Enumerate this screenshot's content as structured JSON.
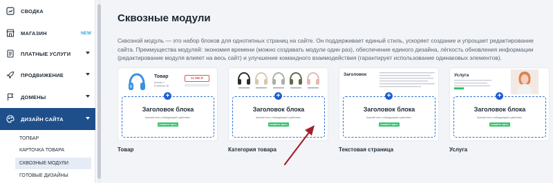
{
  "sidebar": {
    "items": [
      {
        "label": "СВОДКА",
        "icon": "dashboard-icon",
        "chevron": false
      },
      {
        "label": "МАГАЗИН",
        "icon": "store-icon",
        "badge": "NEW",
        "chevron": false
      },
      {
        "label": "ПЛАТНЫЕ УСЛУГИ",
        "icon": "document-icon",
        "chevron": true
      },
      {
        "label": "ПРОДВИЖЕНИЕ",
        "icon": "rocket-icon",
        "chevron": true
      },
      {
        "label": "ДОМЕНЫ",
        "icon": "flag-icon",
        "chevron": true
      },
      {
        "label": "ДИЗАЙН САЙТА",
        "icon": "palette-icon",
        "chevron": true,
        "active": true
      }
    ],
    "subitems": [
      {
        "label": "ТОПБАР"
      },
      {
        "label": "КАРТОЧКА ТОВАРА"
      },
      {
        "label": "СКВОЗНЫЕ МОДУЛИ",
        "active": true
      },
      {
        "label": "ГОТОВЫЕ ДИЗАЙНЫ"
      }
    ]
  },
  "main": {
    "title": "Сквозные модули",
    "description": "Сквозной модуль — это набор блоков для однотипных страниц на сайте. Он поддерживает единый стиль, ускоряет создание и упрощает редактирование сайта. Преимущества модулей: экономия времени (можно создавать модули один раз), обеспечение единого дизайна, лёгкость обновления информации (редактирование модуля влияет на весь сайт) и улучшение командного взаимодействия (гарантирует использование одинаковых элементов).",
    "cards": [
      {
        "label": "Товар",
        "block_title": "Заголовок блока",
        "block_sub": "Краткий текст, побуждающий к действию.",
        "block_btn": "НАЖМИТЕ ЗДЕСЬ",
        "preview": {
          "heading": "Товар",
          "price": "12 990 ₽",
          "line1": "Артикул: 1",
          "line2": "В наличии: 58"
        }
      },
      {
        "label": "Категория товара",
        "block_title": "Заголовок блока",
        "block_sub": "Краткий текст, побуждающий к действию.",
        "block_btn": "НАЖМИТЕ ЗДЕСЬ"
      },
      {
        "label": "Текстовая страница",
        "block_title": "Заголовок блока",
        "block_sub": "Краткий текст, побуждающий к действию.",
        "block_btn": "НАЖМИТЕ ЗДЕСЬ",
        "preview": {
          "heading": "Заголовок"
        }
      },
      {
        "label": "Услуга",
        "block_title": "Заголовок блока",
        "block_sub": "Краткий текст, побуждающий к действию.",
        "block_btn": "НАЖМИТЕ ЗДЕСЬ",
        "preview": {
          "heading": "Услуга"
        }
      }
    ]
  },
  "colors": {
    "active_nav": "#1e4f8a",
    "accent_blue": "#1f5fd1",
    "button_green": "#36c26a",
    "annotation_arrow": "#a3202a",
    "badge_new": "#29a8e0"
  }
}
